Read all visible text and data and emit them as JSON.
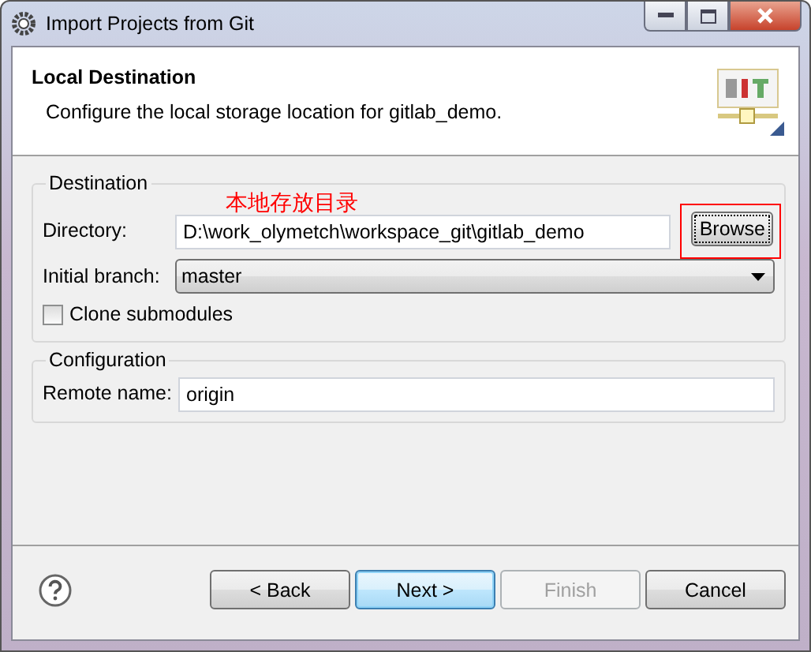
{
  "window": {
    "title": "Import Projects from Git"
  },
  "header": {
    "title": "Local Destination",
    "description": "Configure the local storage location for gitlab_demo."
  },
  "destination": {
    "title": "Destination",
    "directory_label": "Directory:",
    "directory_value": "D:\\work_olymetch\\workspace_git\\gitlab_demo",
    "browse_button": "Browse",
    "annotation": "本地存放目录",
    "branch_label": "Initial branch:",
    "branch_value": "master",
    "clone_submodules": {
      "label": "Clone submodules",
      "checked": false
    }
  },
  "configuration": {
    "title": "Configuration",
    "remote_label": "Remote name:",
    "remote_value": "origin"
  },
  "buttons": [
    {
      "label": "< Back",
      "kind": "normal",
      "disabled": false
    },
    {
      "label": "Next >",
      "kind": "default",
      "disabled": false
    },
    {
      "label": "Finish",
      "kind": "normal",
      "disabled": true
    },
    {
      "label": "Cancel",
      "kind": "normal",
      "disabled": false
    }
  ]
}
